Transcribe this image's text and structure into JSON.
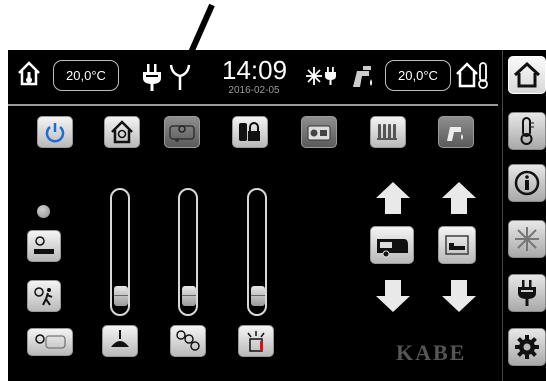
{
  "status_bar": {
    "inside_temperature": "20,0°C",
    "outside_temperature": "20,0°C",
    "time": "14:09",
    "date": "2016-02-05"
  },
  "icons": {
    "status": [
      "home-thermometer-icon",
      "power-plug-icon",
      "antenna-icon",
      "snowflake-plug-icon",
      "water-tap-icon",
      "outside-thermometer-icon"
    ],
    "top_row": [
      "power-icon",
      "home-light-icon",
      "caravan-light-icon",
      "gas-lock-icon",
      "radio-icon",
      "radiator-icon",
      "water-heater-icon"
    ],
    "sidebar": [
      "home-icon",
      "thermometer-icon",
      "info-icon",
      "snowflake-icon",
      "power-plug-icon",
      "settings-gear-icon"
    ]
  },
  "sliders": [
    {
      "name": "ceiling-lamp-dimmer",
      "level": 0.04
    },
    {
      "name": "spotlights-dimmer",
      "level": 0.04
    },
    {
      "name": "wall-lamp-dimmer",
      "level": 0.04
    }
  ],
  "brand": "KABE",
  "colors": {
    "screen_background": "#000000",
    "indicator_led": "#8f8f8f"
  }
}
